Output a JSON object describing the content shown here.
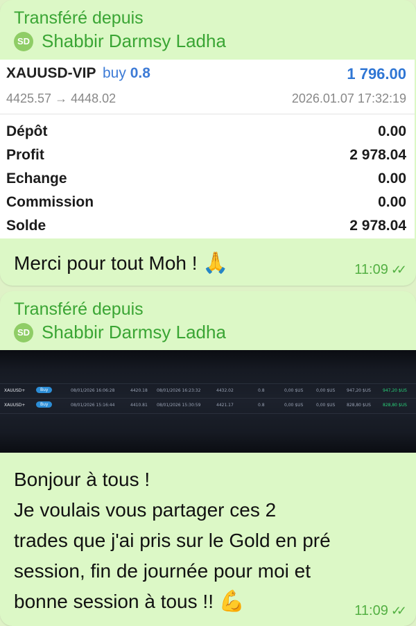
{
  "messages": [
    {
      "forwarded_label": "Transféré depuis",
      "sender": {
        "initials": "SD",
        "name": "Shabbir Darmsy Ladha"
      },
      "trade": {
        "symbol": "XAUUSD-VIP",
        "direction": "buy",
        "lot": "0.8",
        "result": "1 796.00",
        "price_open": "4425.57",
        "arrow": "→",
        "price_close": "4448.02",
        "datetime": "2026.01.07 17:32:19",
        "rows": [
          {
            "label": "Dépôt",
            "value": "0.00"
          },
          {
            "label": "Profit",
            "value": "2 978.04"
          },
          {
            "label": "Echange",
            "value": "0.00"
          },
          {
            "label": "Commission",
            "value": "0.00"
          },
          {
            "label": "Solde",
            "value": "2 978.04"
          }
        ]
      },
      "text": "Merci pour tout Moh !",
      "emoji": "🙏",
      "time": "11:09",
      "ticks": "✓✓"
    },
    {
      "forwarded_label": "Transféré depuis",
      "sender": {
        "initials": "SD",
        "name": "Shabbir Darmsy Ladha"
      },
      "screenshot_rows": [
        {
          "symbol": "XAUUSD+",
          "side": "Buy",
          "open_time": "08/01/2026 16:06:28",
          "open_price": "4420.18",
          "close_time": "08/01/2026 16:23:32",
          "close_price": "4432.02",
          "volume": "0.8",
          "swap": "0,00 $US",
          "commission": "0,00 $US",
          "gross": "947,20 $US",
          "net": "947,20 $US"
        },
        {
          "symbol": "XAUUSD+",
          "side": "Buy",
          "open_time": "08/01/2026 15:16:44",
          "open_price": "4410.81",
          "close_time": "08/01/2026 15:30:59",
          "close_price": "4421.17",
          "volume": "0.8",
          "swap": "0,00 $US",
          "commission": "0,00 $US",
          "gross": "828,80 $US",
          "net": "828,80 $US"
        }
      ],
      "text_lines": [
        "Bonjour à tous !",
        "Je voulais vous partager ces 2",
        "trades que j'ai pris sur le Gold en pré",
        "session, fin de journée pour moi et",
        "bonne session à tous !!"
      ],
      "emoji": "💪",
      "time": "11:09",
      "ticks": "✓✓"
    }
  ],
  "colors": {
    "bubble": "#dcf8c6",
    "sender_green": "#3aa534",
    "profit_blue": "#2f76d4",
    "buy_badge": "#2c8dd6",
    "pnl_green": "#29d27a"
  }
}
